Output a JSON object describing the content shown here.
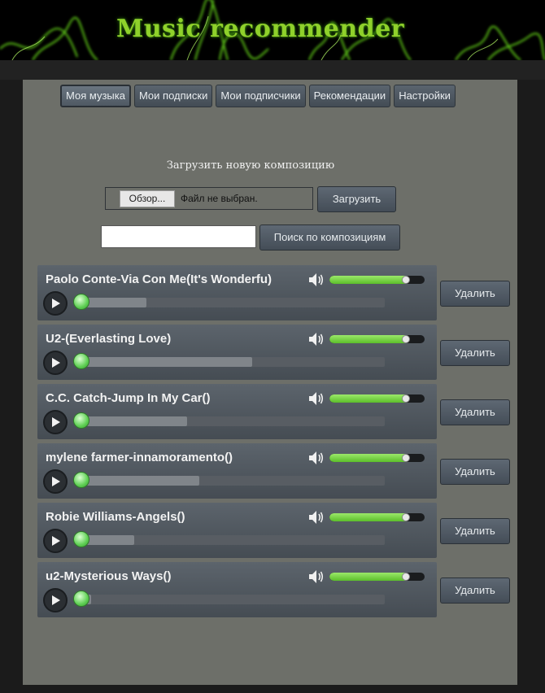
{
  "header": {
    "title": "Music recommender"
  },
  "nav": {
    "tabs": [
      {
        "label": "Моя музыка",
        "active": true
      },
      {
        "label": "Мои подписки",
        "active": false
      },
      {
        "label": "Мои подписчики",
        "active": false
      },
      {
        "label": "Рекомендации",
        "active": false
      },
      {
        "label": "Настройки",
        "active": false
      }
    ]
  },
  "upload": {
    "label": "Загрузить новую композицию",
    "browse_label": "Обзор...",
    "file_status": "Файл не выбран.",
    "submit_label": "Загрузить"
  },
  "search": {
    "value": "",
    "button_label": "Поиск по композициям"
  },
  "tracks": [
    {
      "title": "Paolo Conte-Via Con Me(It's Wonderfu)",
      "progress": 0.23,
      "volume": 0.8,
      "delete_label": "Удалить"
    },
    {
      "title": "U2-(Everlasting Love)",
      "progress": 0.57,
      "volume": 0.8,
      "delete_label": "Удалить"
    },
    {
      "title": "C.C. Catch-Jump In My Car()",
      "progress": 0.36,
      "volume": 0.8,
      "delete_label": "Удалить"
    },
    {
      "title": "mylene farmer-innamoramento()",
      "progress": 0.4,
      "volume": 0.8,
      "delete_label": "Удалить"
    },
    {
      "title": "Robie Williams-Angels()",
      "progress": 0.19,
      "volume": 0.8,
      "delete_label": "Удалить"
    },
    {
      "title": "u2-Mysterious Ways()",
      "progress": 0.05,
      "volume": 0.8,
      "delete_label": "Удалить"
    }
  ],
  "colors": {
    "accent_green": "#8fd12b",
    "volume_fill": "#6fd23c",
    "panel_bg": "#6d6f69"
  },
  "icons": {
    "speaker": "speaker-icon",
    "play": "play-icon"
  }
}
